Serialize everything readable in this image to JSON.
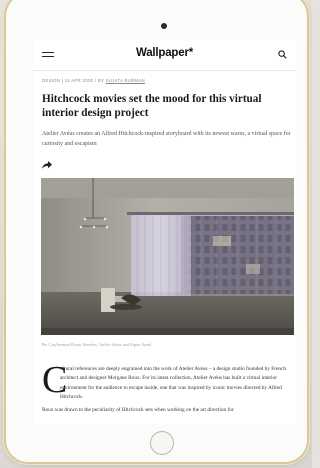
{
  "header": {
    "logo": "Wallpaper*"
  },
  "article": {
    "category": "DESIGN",
    "date": "14 APR 2020",
    "by_prefix": "BY",
    "author": "SUJATA BURMAN",
    "headline": "Hitchcock movies set the mood for this virtual interior design project",
    "standfirst": "Atelier Avéus creates an Alfred Hitchcock-inspired storyboard with its newest wares, a virtual space for curiosity and escapism",
    "caption": "The Confinement Room. Renders: Atelier Avéus and Ergun Aynal",
    "dropcap": "C",
    "paragraph_1": "ultural references are deeply engrained into the work of Atelier Avéus – a design studio founded by French architect and designer Morgane Roux. For its latest collection, Atelier Avéus has built a virtual interior environment for the audience to escape inside, one that was inspired by iconic movies directed by Alfred Hitchcock.",
    "paragraph_2": "Roux was drawn to the peculiarity of Hitchcock sets when working on the art direction for"
  },
  "icons": {
    "menu": "hamburger-menu-icon",
    "search": "search-icon",
    "share": "share-arrow-icon",
    "home": "home-button"
  },
  "colors": {
    "frame_gold": "#d9c79a",
    "text_dark": "#1a1a1a",
    "meta_grey": "#8a8a8a"
  }
}
